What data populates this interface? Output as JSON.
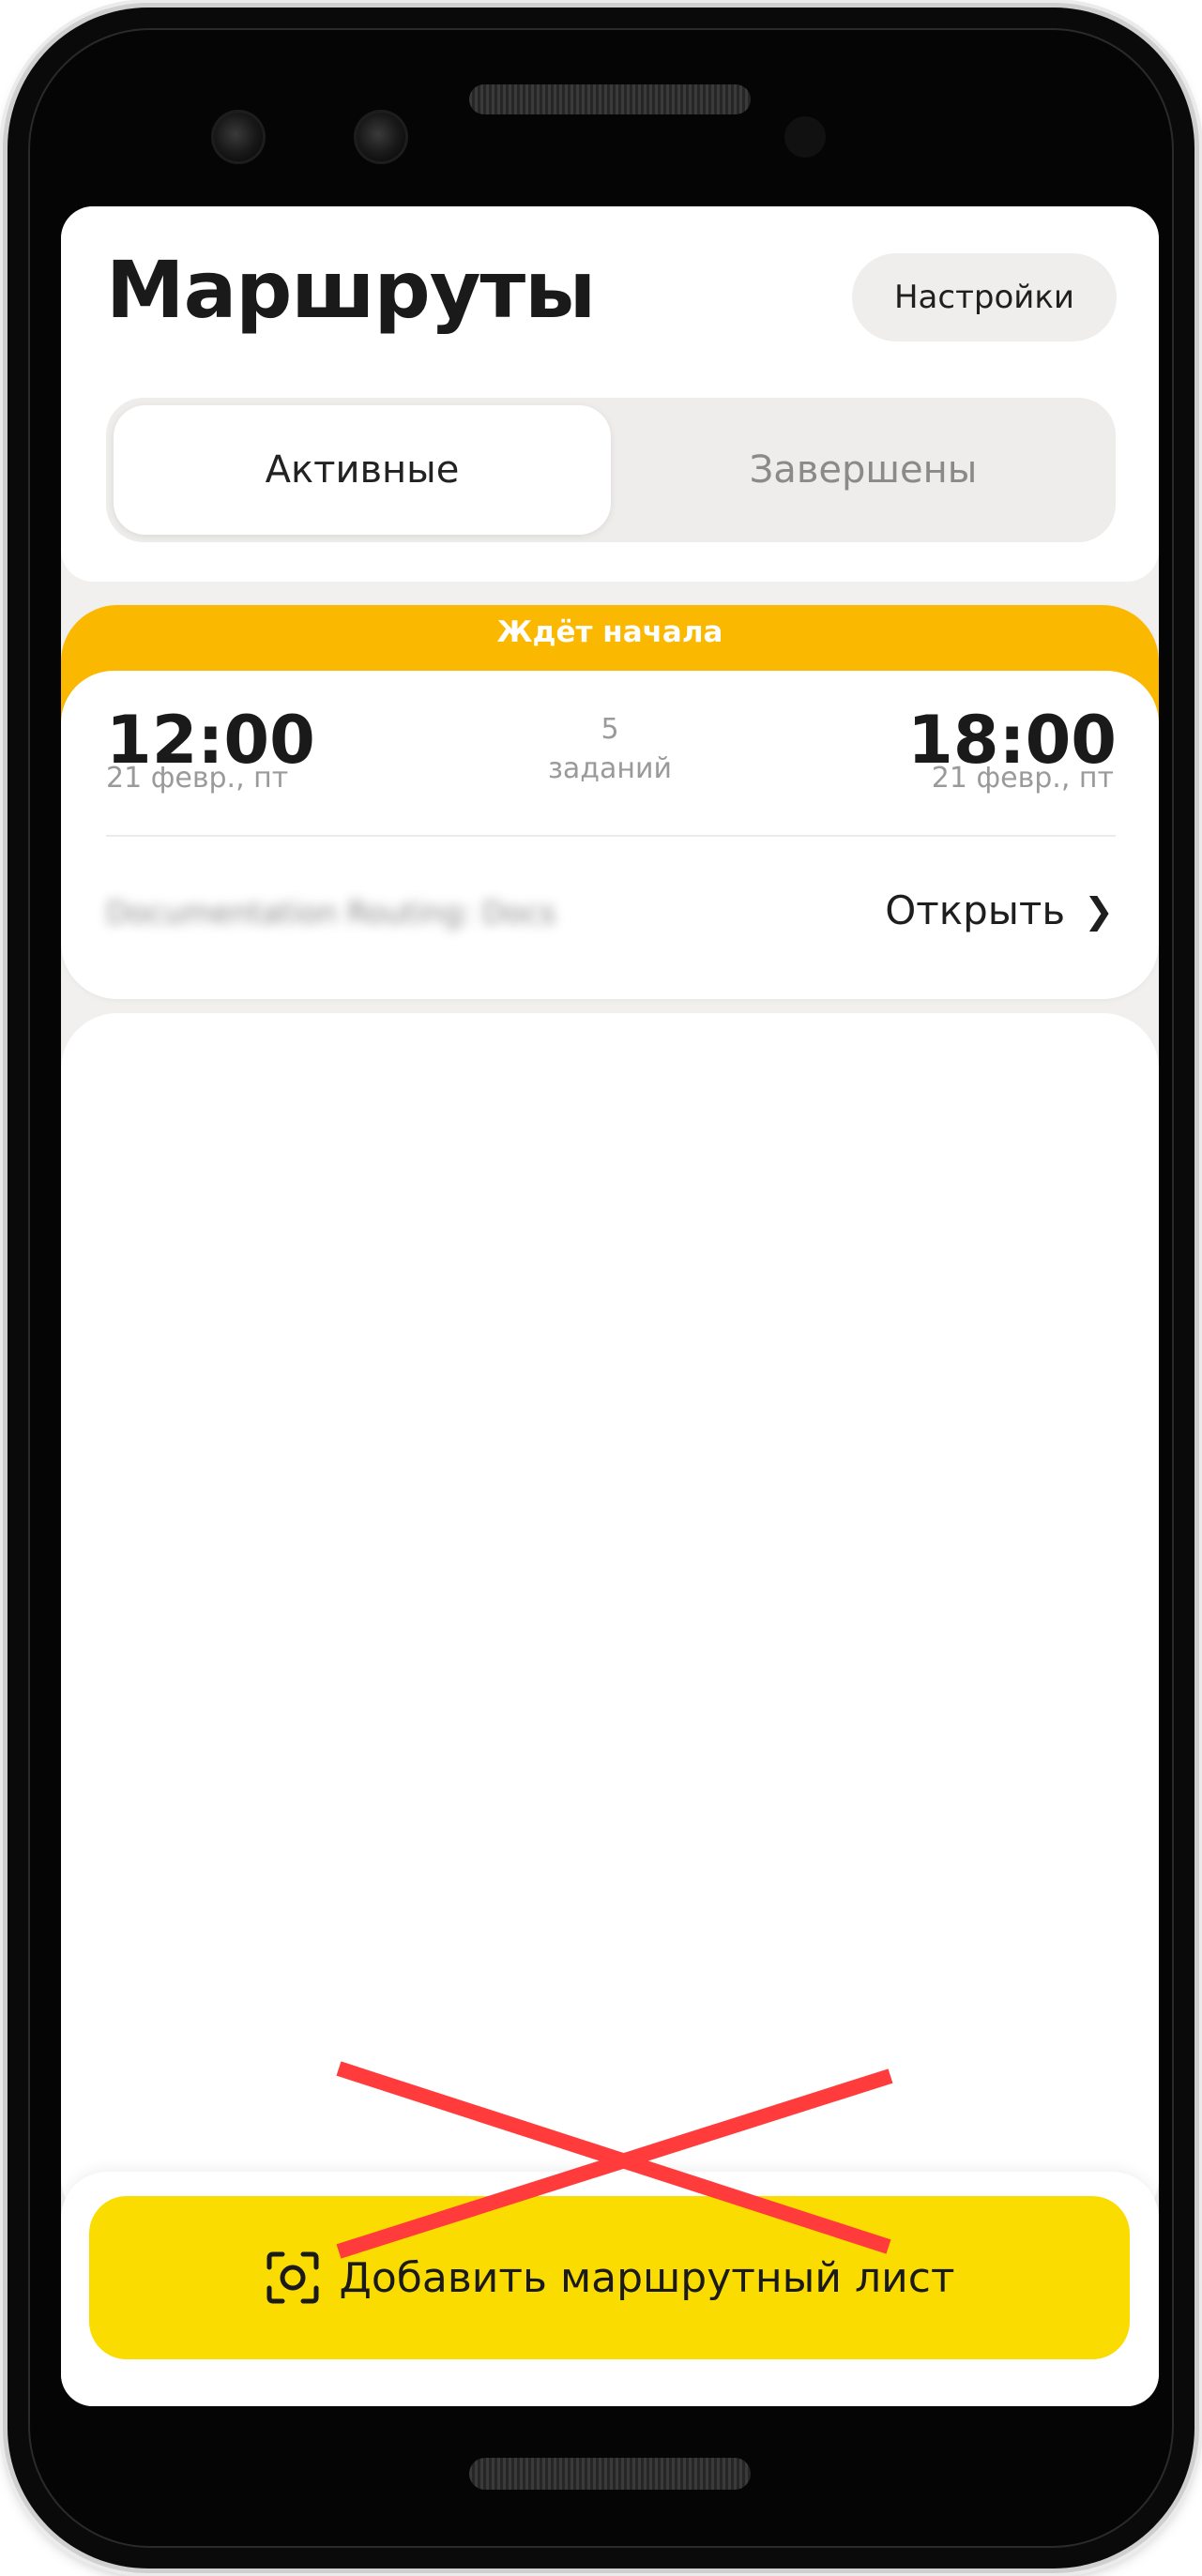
{
  "header": {
    "title": "Маршруты",
    "settings_label": "Настройки"
  },
  "tabs": {
    "active_label": "Активные",
    "completed_label": "Завершены",
    "selected": "Активные"
  },
  "route_card": {
    "status": "Ждёт начала",
    "start_time": "12:00",
    "start_date": "21 февр., пт",
    "tasks_count": "5",
    "tasks_label": "заданий",
    "end_time": "18:00",
    "end_date": "21 февр., пт",
    "route_name": "Documentation Routing: Docs",
    "open_label": "Открыть",
    "status_color": "#fbb800"
  },
  "bottom": {
    "add_button_label": "Добавить маршрутный лист",
    "add_button_icon": "scan-icon",
    "button_color": "#fbdc00",
    "strike_color": "#ff3b3b"
  }
}
